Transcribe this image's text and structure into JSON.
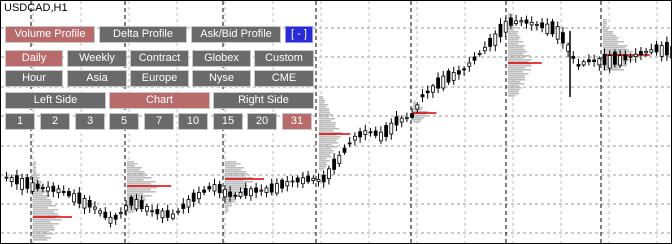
{
  "symbol": "USDCAD,H1",
  "panel": {
    "profile_buttons": [
      {
        "label": "Volume Profile",
        "active": true
      },
      {
        "label": "Delta Profile",
        "active": false
      },
      {
        "label": "Ask/Bid Profile",
        "active": false
      }
    ],
    "collapse_label": "[ - ]",
    "period_rows": [
      [
        {
          "label": "Daily",
          "active": true
        },
        {
          "label": "Weekly",
          "active": false
        },
        {
          "label": "Contract",
          "active": false
        },
        {
          "label": "Globex",
          "active": false
        },
        {
          "label": "Custom",
          "active": false
        }
      ],
      [
        {
          "label": "Hour",
          "active": false
        },
        {
          "label": "Asia",
          "active": false
        },
        {
          "label": "Europe",
          "active": false
        },
        {
          "label": "Nyse",
          "active": false
        },
        {
          "label": "CME",
          "active": false
        }
      ]
    ],
    "side_buttons": [
      {
        "label": "Left Side",
        "active": false
      },
      {
        "label": "Chart",
        "active": true
      },
      {
        "label": "Right Side",
        "active": false
      }
    ],
    "count_buttons": [
      {
        "label": "1",
        "active": false
      },
      {
        "label": "2",
        "active": false
      },
      {
        "label": "3",
        "active": false
      },
      {
        "label": "5",
        "active": false
      },
      {
        "label": "7",
        "active": false
      },
      {
        "label": "10",
        "active": false
      },
      {
        "label": "15",
        "active": false
      },
      {
        "label": "20",
        "active": false
      },
      {
        "label": "31",
        "active": true
      }
    ]
  },
  "colors": {
    "button_gray": "#6a6a6a",
    "button_active": "#b96b6b",
    "button_collapse": "#2a2ad6",
    "profile_fill": "#bdbdbd",
    "poc_line": "#e00000",
    "candles": "#000000",
    "grid": "#9a9a9a",
    "session_separator": "#000000"
  }
}
